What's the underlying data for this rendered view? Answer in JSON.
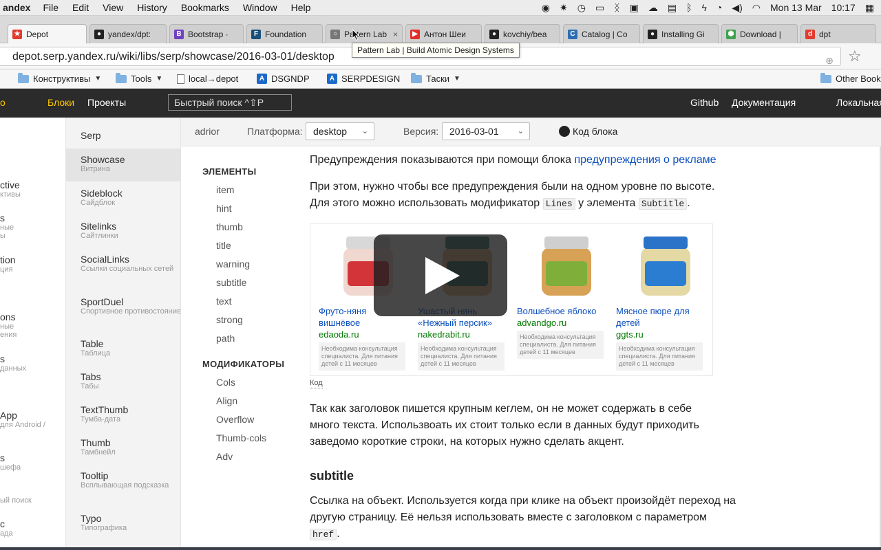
{
  "menubar": {
    "app": "andex",
    "items": [
      "File",
      "Edit",
      "View",
      "History",
      "Bookmarks",
      "Window",
      "Help"
    ],
    "date": "Mon 13 Mar",
    "time": "10:17"
  },
  "tabs": [
    {
      "label": "Depot",
      "color": "#e23b2e",
      "glyph": "★",
      "active": true
    },
    {
      "label": "yandex/dpt:",
      "color": "#222222",
      "glyph": "●",
      "active": false
    },
    {
      "label": "Bootstrap ·",
      "color": "#6f42c1",
      "glyph": "B",
      "active": false
    },
    {
      "label": "Foundation",
      "color": "#1a4f7a",
      "glyph": "F",
      "active": false
    },
    {
      "label": "Pattern Lab",
      "color": "#777777",
      "glyph": "○",
      "active": false
    },
    {
      "label": "Антон Шеи",
      "color": "#e52d27",
      "glyph": "▶",
      "active": false
    },
    {
      "label": "kovchiy/bea",
      "color": "#222222",
      "glyph": "●",
      "active": false
    },
    {
      "label": "Catalog | Co",
      "color": "#2d6db5",
      "glyph": "C",
      "active": false
    },
    {
      "label": "Installing Gi",
      "color": "#222222",
      "glyph": "●",
      "active": false
    },
    {
      "label": "Download |",
      "color": "#3fa34d",
      "glyph": "⬢",
      "active": false
    },
    {
      "label": "dpt",
      "color": "#e23b2e",
      "glyph": "d",
      "active": false
    }
  ],
  "tab_tooltip": "Pattern Lab | Build Atomic Design Systems",
  "address": {
    "url": "depot.serp.yandex.ru/wiki/libs/serp/showcase/2016-03-01/desktop"
  },
  "bookmarks": [
    {
      "label": "Конструктивы",
      "kind": "folder",
      "menu": true
    },
    {
      "label": "Tools",
      "kind": "folder",
      "menu": true
    },
    {
      "label": "local→depot",
      "kind": "doc",
      "menu": false
    },
    {
      "label": "DSGNDP",
      "kind": "a",
      "menu": false
    },
    {
      "label": "SERPDESIGN",
      "kind": "a",
      "menu": false
    },
    {
      "label": "Таски",
      "kind": "folder",
      "menu": true
    },
    {
      "label": "Other Book",
      "kind": "folder",
      "menu": false
    }
  ],
  "siteheader": {
    "logo_fragment": "о",
    "blocks": "Блоки",
    "projects": "Проекты",
    "search": "Быстрый поиск ^⇧P",
    "github": "Github",
    "docs": "Документация",
    "local": "Локальная"
  },
  "leftcol": [
    {
      "t": "ctive",
      "s": "ктивы"
    },
    {
      "t": "s",
      "s": "ные"
    },
    {
      "t": "",
      "s": "ы"
    },
    {
      "t": "tion",
      "s": "ция"
    },
    {
      "t": "ons",
      "s": "ные"
    },
    {
      "t": "",
      "s": "ения"
    },
    {
      "t": "s",
      "s": "данных"
    },
    {
      "t": "App",
      "s": "для Android /"
    },
    {
      "t": "s",
      "s": "шефа"
    },
    {
      "t": "",
      "s": "ый поиск"
    },
    {
      "t": "c",
      "s": "ада"
    }
  ],
  "blocks": [
    {
      "t": "Serp",
      "s": ""
    },
    {
      "t": "Showcase",
      "s": "Витрина",
      "active": true
    },
    {
      "t": "Sideblock",
      "s": "Сайдблок"
    },
    {
      "t": "Sitelinks",
      "s": "Сайтлинки"
    },
    {
      "t": "SocialLinks",
      "s": "Ссылки социальных сетей"
    },
    {
      "t": "SportDuel",
      "s": "Спортивное противостояние"
    },
    {
      "t": "Table",
      "s": "Таблица"
    },
    {
      "t": "Tabs",
      "s": "Табы"
    },
    {
      "t": "TextThumb",
      "s": "Тумба-дата"
    },
    {
      "t": "Thumb",
      "s": "Тамбнейл"
    },
    {
      "t": "Tooltip",
      "s": "Всплывающая подсказка"
    },
    {
      "t": "Typo",
      "s": "Типографика"
    }
  ],
  "toolbar": {
    "author": "adrior",
    "platform_label": "Платформа:",
    "platform_value": "desktop",
    "version_label": "Версия:",
    "version_value": "2016-03-01",
    "code_link": "Код блока"
  },
  "elnav": {
    "elements_heading": "ЭЛЕМЕНТЫ",
    "elements": [
      "item",
      "hint",
      "thumb",
      "title",
      "warning",
      "subtitle",
      "text",
      "strong",
      "path"
    ],
    "modifiers_heading": "МОДИФИКАТОРЫ",
    "modifiers": [
      "Cols",
      "Align",
      "Overflow",
      "Thumb-cols",
      "Adv"
    ]
  },
  "content": {
    "p1_text": "Предупреждения показываются при помощи блока ",
    "p1_link": "предупреждения о рекламе",
    "p2_a": "При этом, нужно чтобы все предупреждения были на одном уровне по высоте.",
    "p2_b": "Для этого можно использовать модификатор ",
    "p2_code1": "Lines",
    "p2_c": " у элемента ",
    "p2_code2": "Subtitle",
    "p2_d": ".",
    "code_link": "Код",
    "p3": "Так как заголовок пишется крупным кеглем, он не может содержать в себе много текста. Использвоать их стоит только если в данных будут приходить заведомо короткие строки, на которых нужно сделать акцент.",
    "h_subtitle": "subtitle",
    "p4_a": "Ссылка на объект. Используется когда при клике на объект произойдёт переход на другую страницу. Её нельзя использовать вместе с заголовком с параметром ",
    "p4_code": "href",
    "p4_b": "."
  },
  "showcase": [
    {
      "title": "Фруто-няня вишнёвое",
      "domain": "edaoda.ru",
      "warning": "Необходима консультация специалиста. Для питания детей с 11 месяцев",
      "lid": "#d8d8d8",
      "body": "#f0d7d0",
      "label": "#d2343a"
    },
    {
      "title": "Ушастый нянь «Нежный персик»",
      "domain": "nakedrabit.ru",
      "warning": "Необходима консультация специалиста. Для питания детей с 11 месяцев",
      "lid": "#3c7c73",
      "body": "#e7b48a",
      "label": "#2f6a62"
    },
    {
      "title": "Волшебное яблоко",
      "domain": "advandgo.ru",
      "warning": "Необходима консультация специалиста. Для питания детей с 11 месяцев",
      "lid": "#cfcfcf",
      "body": "#d7a255",
      "label": "#7fae3b"
    },
    {
      "title": "Мясное пюре для детей",
      "domain": "ggts.ru",
      "warning": "Необходима консультация специалиста. Для питания детей с 11 месяцев",
      "lid": "#2a73c9",
      "body": "#e4d8a4",
      "label": "#2b7dd2"
    }
  ]
}
